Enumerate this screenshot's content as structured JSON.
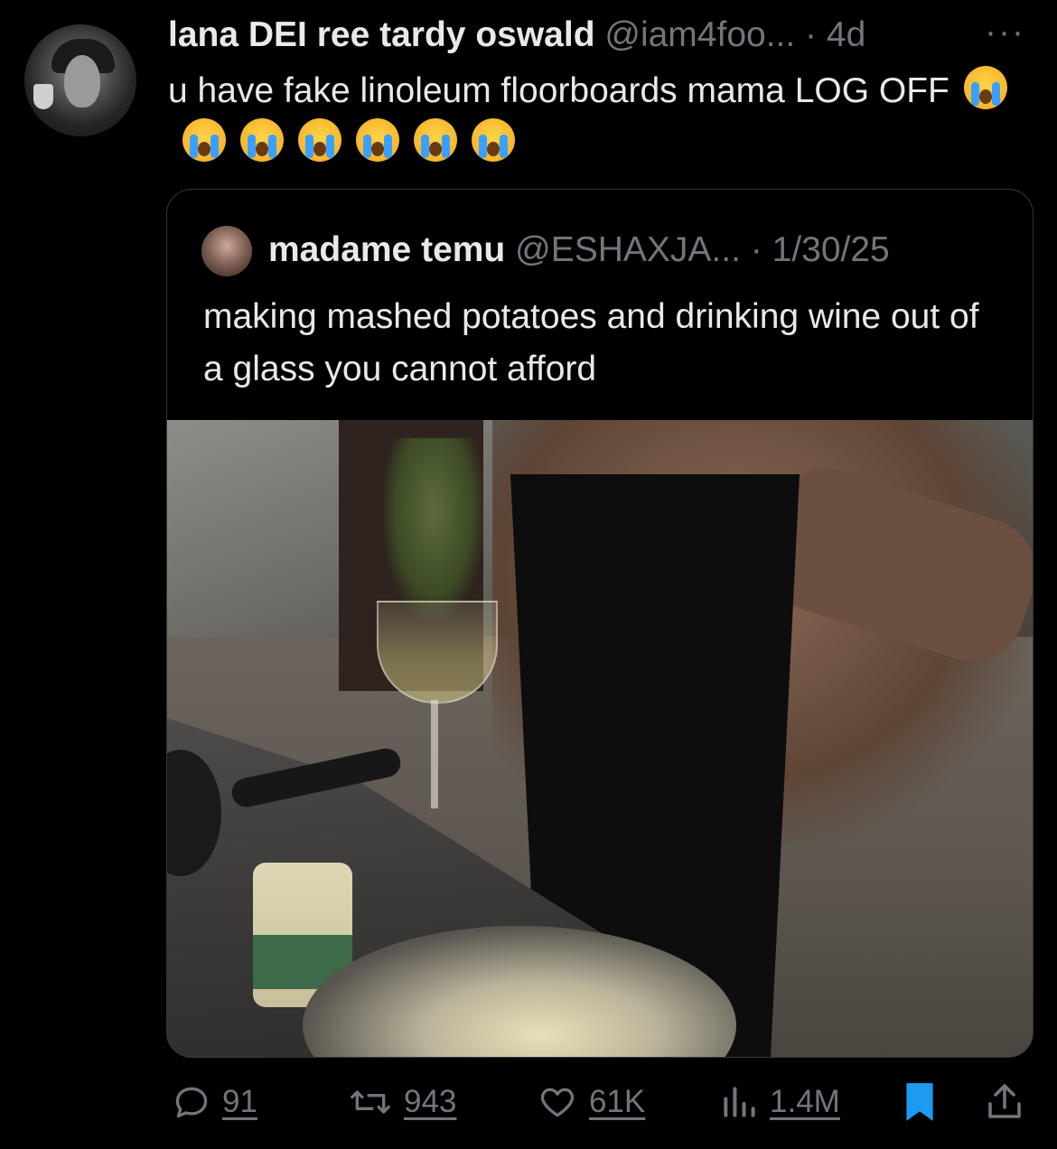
{
  "tweet": {
    "author_name": "lana DEI ree tardy oswald",
    "handle": "@iam4foo...",
    "separator": "·",
    "time": "4d",
    "more_label": "···",
    "text": "u have fake linoleum floorboards mama LOG OFF",
    "emoji_count": 7
  },
  "quoted_tweet": {
    "author_name": "madame temu",
    "handle": "@ESHAXJA...",
    "separator": "·",
    "date": "1/30/25",
    "text": "making mashed potatoes and drinking wine out of a glass you cannot afford"
  },
  "actions": {
    "replies": "91",
    "reposts": "943",
    "likes": "61K",
    "views": "1.4M"
  },
  "colors": {
    "background": "#000000",
    "text": "#e7e9ea",
    "muted": "#71767b",
    "bookmark_active": "#1d9bf0"
  }
}
